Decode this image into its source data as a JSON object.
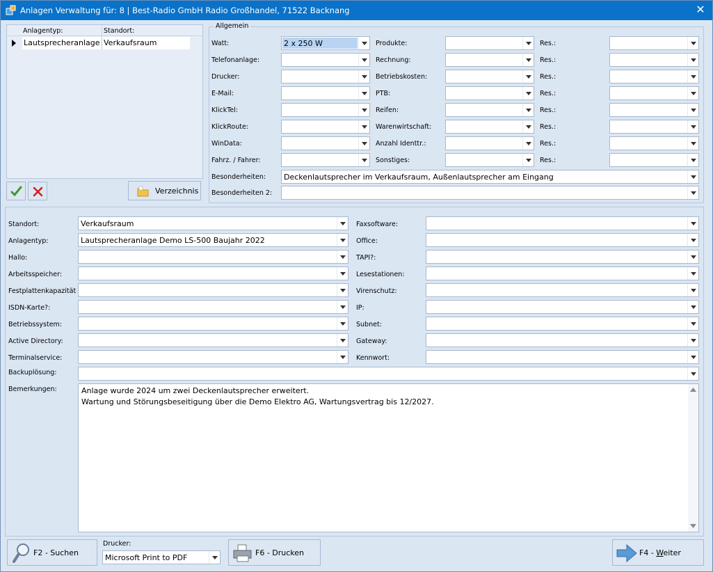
{
  "window": {
    "title": "Anlagen Verwaltung für: 8 | Best-Radio GmbH Radio Großhandel, 71522 Backnang",
    "close_glyph": "✕"
  },
  "grid": {
    "columns": [
      "Anlagentyp:",
      "Standort:"
    ],
    "rows": [
      {
        "anlagentyp": "Lautsprecheranlage",
        "standort": "Verkaufsraum"
      }
    ]
  },
  "buttons": {
    "verzeichnis": "Verzeichnis",
    "suchen": "F2 - Suchen",
    "drucken": "F6 - Drucken",
    "weiter_prefix": "F4 - ",
    "weiter_key": "W",
    "weiter_rest": "eiter"
  },
  "allgemein": {
    "title": "Allgemein",
    "col1": [
      {
        "label": "Watt:",
        "value": "2 x 250 W"
      },
      {
        "label": "Telefonanlage:",
        "value": ""
      },
      {
        "label": "Drucker:",
        "value": ""
      },
      {
        "label": "E-Mail:",
        "value": ""
      },
      {
        "label": "KlickTel:",
        "value": ""
      },
      {
        "label": "KlickRoute:",
        "value": ""
      },
      {
        "label": "WinData:",
        "value": ""
      },
      {
        "label": "Fahrz. / Fahrer:",
        "value": ""
      }
    ],
    "col2": [
      {
        "label": "Produkte:",
        "value": ""
      },
      {
        "label": "Rechnung:",
        "value": ""
      },
      {
        "label": "Betriebskosten:",
        "value": ""
      },
      {
        "label": "PTB:",
        "value": ""
      },
      {
        "label": "Reifen:",
        "value": ""
      },
      {
        "label": "Warenwirtschaft:",
        "value": ""
      },
      {
        "label": "Anzahl Identtr.:",
        "value": ""
      },
      {
        "label": "Sonstiges:",
        "value": ""
      }
    ],
    "col3_label": "Res.:",
    "besonderheiten_label": "Besonderheiten:",
    "besonderheiten_value": "Deckenlautsprecher im Verkaufsraum, Außenlautsprecher am Eingang",
    "besonderheiten2_label": "Besonderheiten 2:",
    "besonderheiten2_value": ""
  },
  "details": {
    "left": [
      {
        "label": "Standort:",
        "value": "Verkaufsraum"
      },
      {
        "label": "Anlagentyp:",
        "value": "Lautsprecheranlage Demo LS-500 Baujahr 2022"
      },
      {
        "label": "Hallo:",
        "value": ""
      },
      {
        "label": "Arbeitsspeicher:",
        "value": ""
      },
      {
        "label": "Festplattenkapazität",
        "value": ""
      },
      {
        "label": "ISDN-Karte?:",
        "value": ""
      },
      {
        "label": "Betriebssystem:",
        "value": ""
      },
      {
        "label": "Active Directory:",
        "value": ""
      },
      {
        "label": "Terminalservice:",
        "value": ""
      }
    ],
    "right": [
      {
        "label": "Faxsoftware:",
        "value": ""
      },
      {
        "label": "Office:",
        "value": ""
      },
      {
        "label": "TAPI?:",
        "value": ""
      },
      {
        "label": "Lesestationen:",
        "value": ""
      },
      {
        "label": "Virenschutz:",
        "value": ""
      },
      {
        "label": "IP:",
        "value": ""
      },
      {
        "label": "Subnet:",
        "value": ""
      },
      {
        "label": "Gateway:",
        "value": ""
      },
      {
        "label": "Kennwort:",
        "value": ""
      }
    ],
    "backup_label": "Backuplösung:",
    "backup_value": "",
    "bemerkungen_label": "Bemerkungen:",
    "bemerkungen_lines": [
      "Anlage wurde 2024 um zwei Deckenlautsprecher erweitert.",
      "Wartung und Störungsbeseitigung über die Demo Elektro AG, Wartungsvertrag bis 12/2027."
    ]
  },
  "footer": {
    "drucker_label": "Drucker:",
    "drucker_value": "Microsoft Print to PDF"
  },
  "icons": [
    "app-icon",
    "close-icon",
    "row-pointer-icon",
    "check-icon",
    "delete-x-icon",
    "folder-icon",
    "magnifier-icon",
    "printer-icon",
    "arrow-right-icon"
  ]
}
